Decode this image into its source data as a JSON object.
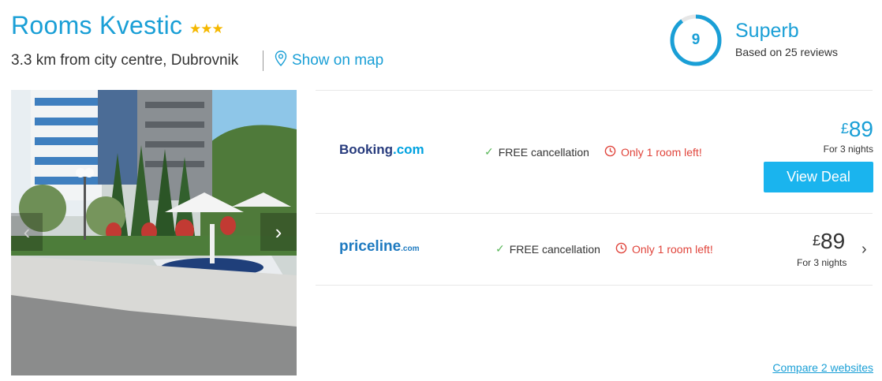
{
  "hotel": {
    "name": "Rooms Kvestic",
    "stars": "★★★",
    "location": "3.3 km from city centre, Dubrovnik",
    "map_link": "Show on map"
  },
  "rating": {
    "score": "9",
    "score_fraction": 0.9,
    "word": "Superb",
    "reviews": "Based on 25 reviews"
  },
  "gallery": {
    "prev_icon": "chevron-left-icon",
    "next_icon": "chevron-right-icon"
  },
  "deals": [
    {
      "provider": "Booking",
      "provider_suffix": ".com",
      "feature": "FREE cancellation",
      "warning": "Only 1 room left!",
      "currency": "£",
      "price": "89",
      "nights": "For 3 nights",
      "button": "View Deal"
    },
    {
      "provider": "priceline",
      "provider_suffix": ".com",
      "feature": "FREE cancellation",
      "warning": "Only 1 room left!",
      "currency": "£",
      "price": "89",
      "nights": "For 3 nights"
    }
  ],
  "compare_link": "Compare 2 websites",
  "colors": {
    "accent": "#1a9fd6",
    "button": "#1ab4ee",
    "warning": "#e0443b",
    "check": "#5cb85c",
    "stars": "#f5b800"
  }
}
